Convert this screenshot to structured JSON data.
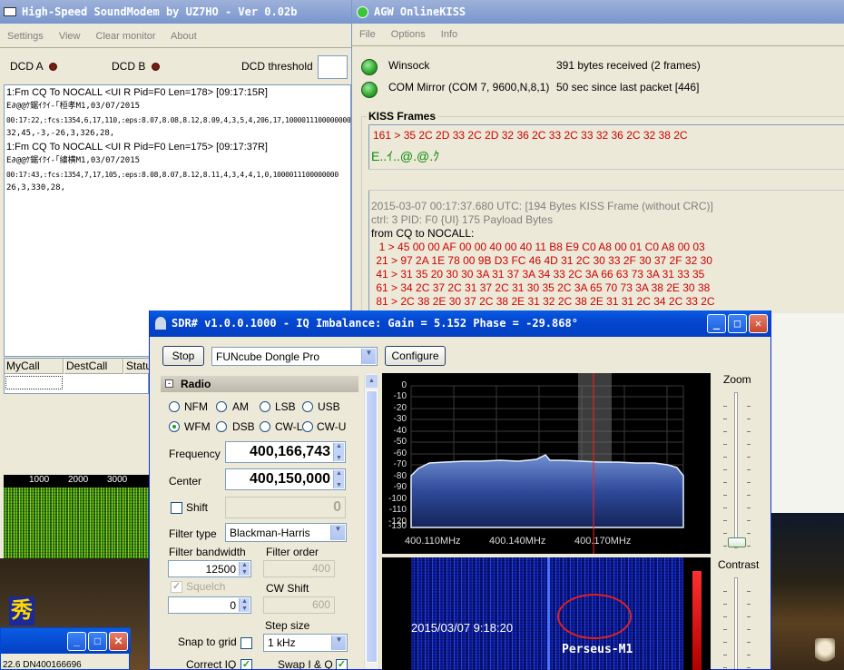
{
  "soundmodem": {
    "title": "High-Speed SoundModem by UZ7HO - Ver 0.02b",
    "menu": [
      "Settings",
      "View",
      "Clear monitor",
      "About"
    ],
    "dcd_a": "DCD A",
    "dcd_b": "DCD B",
    "dcd_threshold": "DCD threshold",
    "monitor": [
      "1:Fm CQ To NOCALL <UI R Pid=F0 Len=178> [09:17:15R]",
      "E∂@@ｹ鋸ｲｸｲ-｢桓孝M1,03/07/2015",
      "00:17:22,:fcs:1354,6,17,110,:eps:8.07,8.08,8.12,8.09,4,3,5,4,206,17,1000011100000000",
      "32,45,-3,-26,3,326,28,",
      "1:Fm CQ To NOCALL <UI R Pid=F0 Len=175> [09:17:37R]",
      "E∂@@ｹ鋸ｲｸｲ-｢繍横M1,03/07/2015",
      "00:17:43,:fcs:1354,7,17,105,:eps:8.08,8.07,8.12,8.11,4,3,4,4,1,0,1000011100000000",
      "26,3,330,28,"
    ],
    "table_headers": [
      "MyCall",
      "DestCall",
      "Statu"
    ],
    "waterfall_ticks": [
      "1000",
      "2000",
      "3000"
    ],
    "bottom_text": "22.6 DN400166696"
  },
  "agw": {
    "title": "AGW OnlineKISS",
    "menu": [
      "File",
      "Options",
      "Info"
    ],
    "status": [
      {
        "name": "Winsock",
        "info": "391 bytes received (2 frames)"
      },
      {
        "name": "COM Mirror (COM 7, 9600,N,8,1)",
        "info": "50 sec since last packet [446]"
      }
    ],
    "kiss_label": "KISS Frames",
    "first_frame_hex": "161 > 35 2C 2D 33 2C 2D 32 36 2C 33 2C 33 32 36 2C 32 38 2C",
    "first_frame_text": "E..ｲ..@.@.ｸ",
    "frame_header": "2015-03-07 00:17:37.680 UTC: [194 Bytes KISS Frame (without CRC)]",
    "frame_ctrl": "ctrl: 3   PID: F0 {UI}   175 Payload Bytes",
    "frame_from": "from CQ to NOCALL:",
    "hex_rows": [
      "  1 > 45 00 00 AF 00 00 40 00 40 11 B8 E9 C0 A8 00 01 C0 A8 00 03",
      " 21 > 97 2A 1E 78 00 9B D3 FC 46 4D 31 2C 30 33 2F 30 37 2F 32 30",
      " 41 > 31 35 20 30 30 3A 31 37 3A 34 33 2C 3A 66 63 73 3A 31 33 35",
      " 61 > 34 2C 37 2C 31 37 2C 31 30 35 2C 3A 65 70 73 3A 38 2E 30 38",
      " 81 > 2C 38 2E 30 37 2C 38 2E 31 32 2C 38 2E 31 31 2C 34 2C 33 2C"
    ]
  },
  "sdr": {
    "title": "SDR# v1.0.0.1000 - IQ Imbalance: Gain = 5.152 Phase = -29.868°",
    "stop_label": "Stop",
    "device": "FUNcube Dongle Pro",
    "configure_label": "Configure",
    "radio_header": "Radio",
    "modes": [
      "NFM",
      "AM",
      "LSB",
      "USB",
      "WFM",
      "DSB",
      "CW-L",
      "CW-U"
    ],
    "selected_mode": "WFM",
    "frequency_label": "Frequency",
    "frequency": "400,166,743",
    "center_label": "Center",
    "center": "400,150,000",
    "shift_label": "Shift",
    "shift": "0",
    "filter_type_label": "Filter type",
    "filter_type": "Blackman-Harris",
    "filter_bandwidth_label": "Filter bandwidth",
    "filter_bandwidth": "12500",
    "filter_order_label": "Filter order",
    "filter_order": "400",
    "squelch_label": "Squelch",
    "squelch": "0",
    "cw_shift_label": "CW Shift",
    "cw_shift": "600",
    "step_size_label": "Step size",
    "step_size": "1 kHz",
    "snap_label": "Snap to grid",
    "correct_iq_label": "Correct IQ",
    "swap_iq_label": "Swap I & Q",
    "zoom_label": "Zoom",
    "contrast_label": "Contrast",
    "db_ticks": [
      "0",
      "-10",
      "-20",
      "-30",
      "-40",
      "-50",
      "-60",
      "-70",
      "-80",
      "-90",
      "-100",
      "-110",
      "-120",
      "-130"
    ],
    "freq_ticks": [
      "400.110MHz",
      "400.140MHz",
      "400.170MHz"
    ],
    "waterfall_time": "2015/03/07 9:18:20",
    "waterfall_label": "Perseus-M1"
  }
}
